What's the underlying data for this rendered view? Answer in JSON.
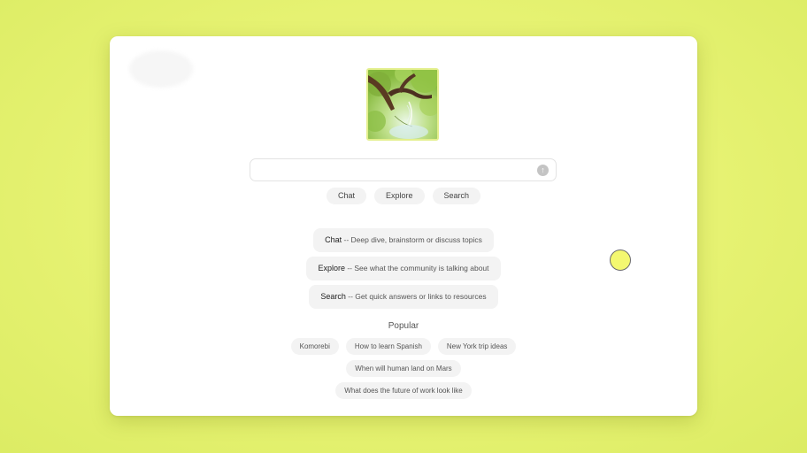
{
  "search": {
    "value": "",
    "placeholder": "",
    "submit_icon": "arrow-up-icon"
  },
  "modes": [
    {
      "label": "Chat"
    },
    {
      "label": "Explore"
    },
    {
      "label": "Search"
    }
  ],
  "descriptions": [
    {
      "name": "Chat",
      "text": " -- Deep dive, brainstorm or discuss topics"
    },
    {
      "name": "Explore",
      "text": " -- See what the community is talking about"
    },
    {
      "name": "Search",
      "text": " -- Get quick answers or links to resources"
    }
  ],
  "popular": {
    "title": "Popular",
    "items": [
      "Komorebi",
      "How to learn Spanish",
      "New York trip ideas",
      "When will human land on Mars",
      "What does the future of work look like"
    ]
  },
  "colors": {
    "background": "#e6f272",
    "card": "#ffffff",
    "pill": "#f3f3f3",
    "cursor_fill": "#f4f870"
  }
}
